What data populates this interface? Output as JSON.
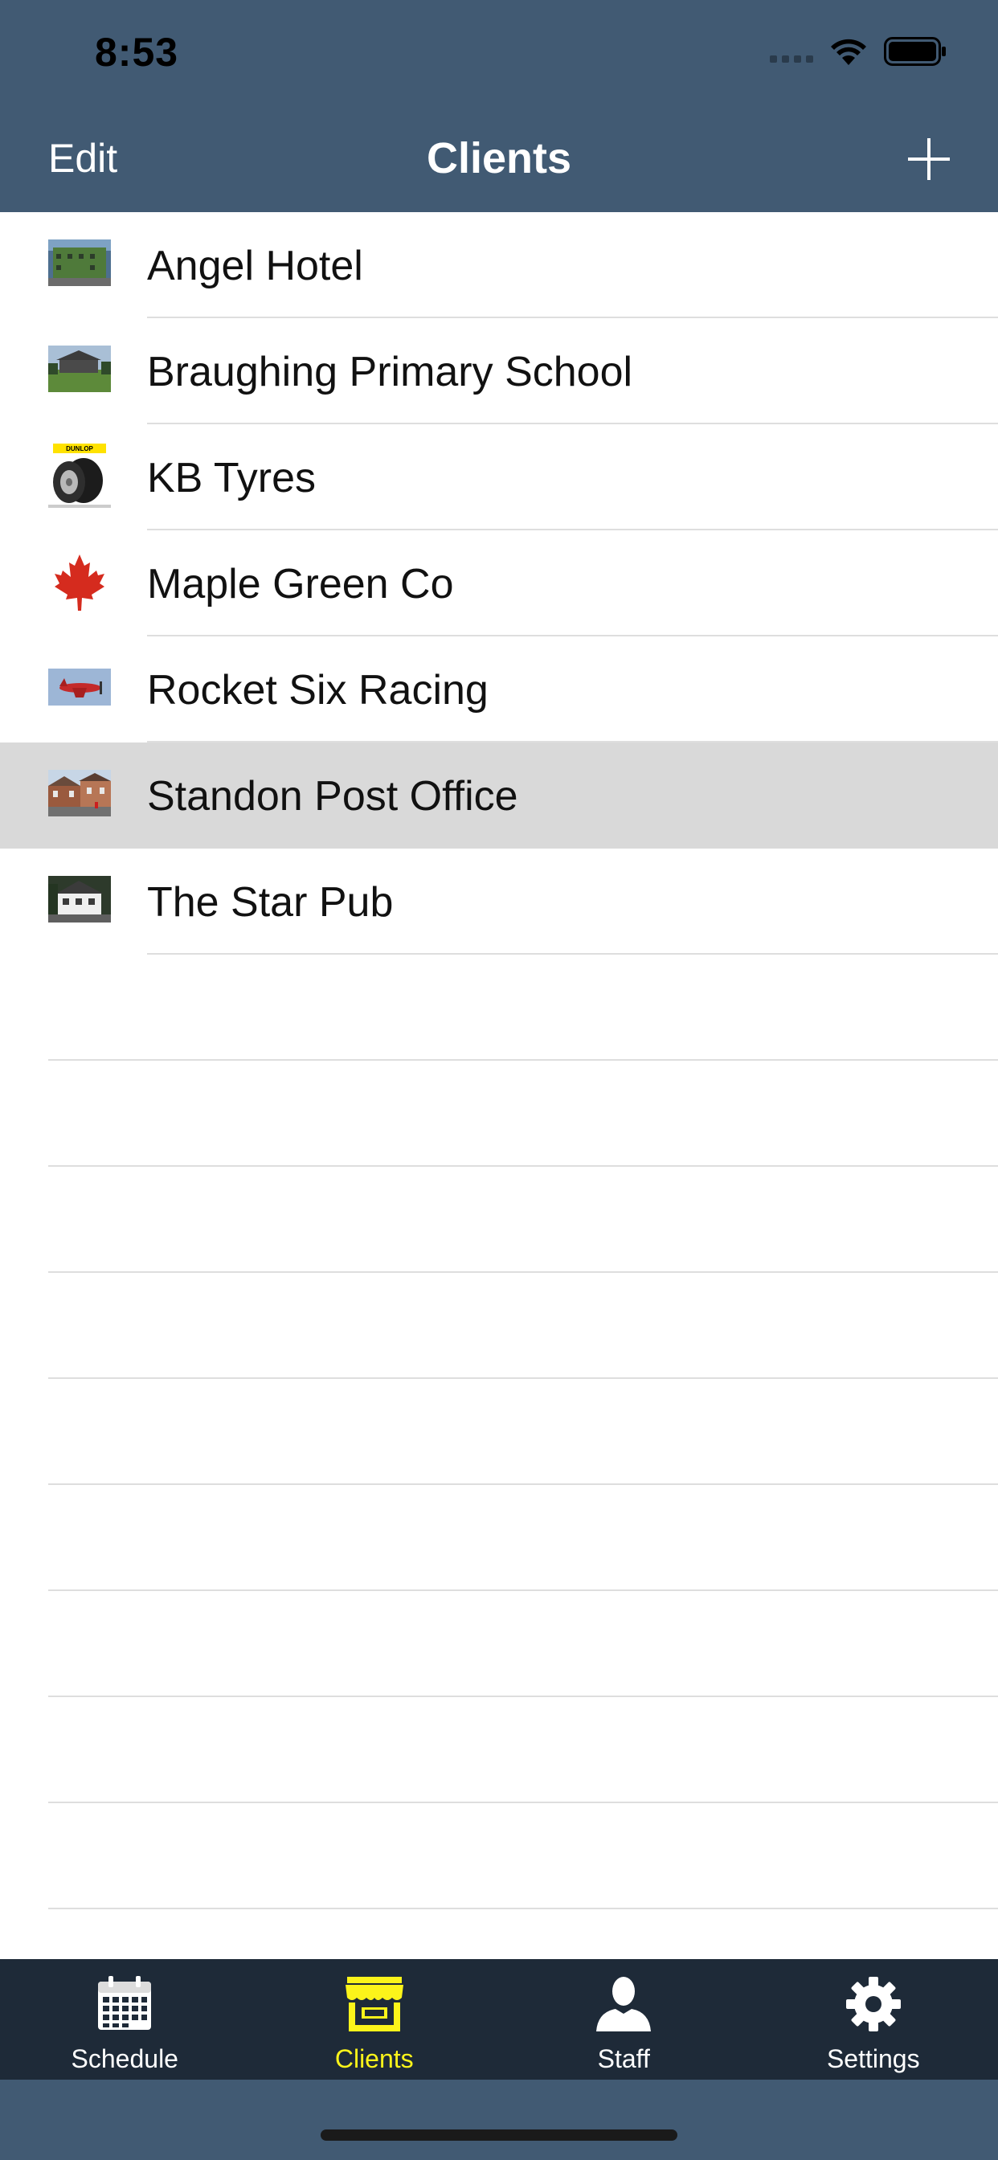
{
  "status_bar": {
    "time": "8:53"
  },
  "nav": {
    "edit_label": "Edit",
    "title": "Clients",
    "add_icon": "plus-icon"
  },
  "clients": [
    {
      "name": "Angel Hotel",
      "thumb": "hotel"
    },
    {
      "name": "Braughing Primary School",
      "thumb": "school"
    },
    {
      "name": "KB Tyres",
      "thumb": "tyres"
    },
    {
      "name": "Maple Green Co",
      "thumb": "maple"
    },
    {
      "name": "Rocket Six Racing",
      "thumb": "plane"
    },
    {
      "name": "Standon Post Office",
      "thumb": "postoffice",
      "selected": true
    },
    {
      "name": "The Star Pub",
      "thumb": "pub"
    }
  ],
  "tyres_thumb_text": "DUNLOP",
  "tabbar": {
    "items": [
      {
        "label": "Schedule",
        "icon": "calendar-icon",
        "active": false
      },
      {
        "label": "Clients",
        "icon": "storefront-icon",
        "active": true
      },
      {
        "label": "Staff",
        "icon": "person-icon",
        "active": false
      },
      {
        "label": "Settings",
        "icon": "gear-icon",
        "active": false
      }
    ],
    "active_color": "#fcf41a",
    "background": "#1e2a38"
  },
  "colors": {
    "header": "#415a73",
    "selected_row": "#d9d9d9"
  }
}
